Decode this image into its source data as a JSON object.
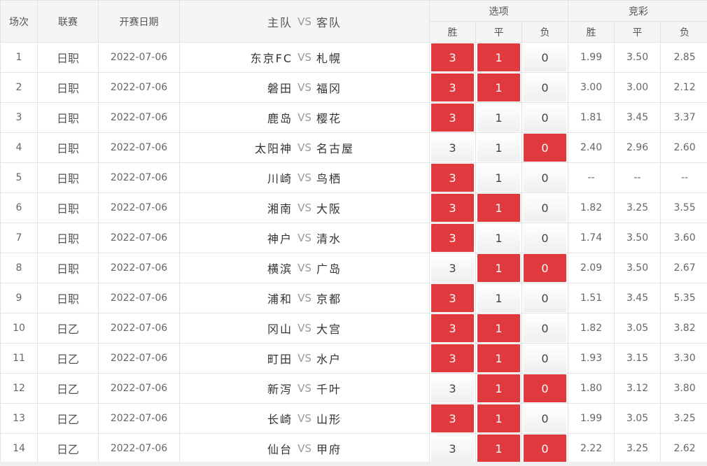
{
  "header": {
    "num": "场次",
    "league": "联赛",
    "date": "开赛日期",
    "home": "主队",
    "vs": "VS",
    "away": "客队",
    "options_group": "选项",
    "odds_group": "竞彩",
    "win": "胜",
    "draw": "平",
    "lose": "负"
  },
  "colors": {
    "selected": "#e03a3e",
    "header_bg": "#f5f5f5",
    "border": "#e3e3e3"
  },
  "rows": [
    {
      "num": "1",
      "league": "日职",
      "date": "2022-07-06",
      "home": "东京FC",
      "away": "札幌",
      "opt": {
        "win": "3",
        "draw": "1",
        "lose": "0"
      },
      "sel": [
        true,
        true,
        false
      ],
      "odds": {
        "win": "1.99",
        "draw": "3.50",
        "lose": "2.85"
      }
    },
    {
      "num": "2",
      "league": "日职",
      "date": "2022-07-06",
      "home": "磐田",
      "away": "福冈",
      "opt": {
        "win": "3",
        "draw": "1",
        "lose": "0"
      },
      "sel": [
        true,
        true,
        false
      ],
      "odds": {
        "win": "3.00",
        "draw": "3.00",
        "lose": "2.12"
      }
    },
    {
      "num": "3",
      "league": "日职",
      "date": "2022-07-06",
      "home": "鹿岛",
      "away": "樱花",
      "opt": {
        "win": "3",
        "draw": "1",
        "lose": "0"
      },
      "sel": [
        true,
        false,
        false
      ],
      "odds": {
        "win": "1.81",
        "draw": "3.45",
        "lose": "3.37"
      }
    },
    {
      "num": "4",
      "league": "日职",
      "date": "2022-07-06",
      "home": "太阳神",
      "away": "名古屋",
      "opt": {
        "win": "3",
        "draw": "1",
        "lose": "0"
      },
      "sel": [
        false,
        false,
        true
      ],
      "odds": {
        "win": "2.40",
        "draw": "2.96",
        "lose": "2.60"
      }
    },
    {
      "num": "5",
      "league": "日职",
      "date": "2022-07-06",
      "home": "川崎",
      "away": "鸟栖",
      "opt": {
        "win": "3",
        "draw": "1",
        "lose": "0"
      },
      "sel": [
        true,
        false,
        false
      ],
      "odds": {
        "win": "--",
        "draw": "--",
        "lose": "--"
      }
    },
    {
      "num": "6",
      "league": "日职",
      "date": "2022-07-06",
      "home": "湘南",
      "away": "大阪",
      "opt": {
        "win": "3",
        "draw": "1",
        "lose": "0"
      },
      "sel": [
        true,
        true,
        false
      ],
      "odds": {
        "win": "1.82",
        "draw": "3.25",
        "lose": "3.55"
      }
    },
    {
      "num": "7",
      "league": "日职",
      "date": "2022-07-06",
      "home": "神户",
      "away": "清水",
      "opt": {
        "win": "3",
        "draw": "1",
        "lose": "0"
      },
      "sel": [
        true,
        false,
        false
      ],
      "odds": {
        "win": "1.74",
        "draw": "3.50",
        "lose": "3.60"
      }
    },
    {
      "num": "8",
      "league": "日职",
      "date": "2022-07-06",
      "home": "横滨",
      "away": "广岛",
      "opt": {
        "win": "3",
        "draw": "1",
        "lose": "0"
      },
      "sel": [
        false,
        true,
        true
      ],
      "odds": {
        "win": "2.09",
        "draw": "3.50",
        "lose": "2.67"
      }
    },
    {
      "num": "9",
      "league": "日职",
      "date": "2022-07-06",
      "home": "浦和",
      "away": "京都",
      "opt": {
        "win": "3",
        "draw": "1",
        "lose": "0"
      },
      "sel": [
        true,
        false,
        false
      ],
      "odds": {
        "win": "1.51",
        "draw": "3.45",
        "lose": "5.35"
      }
    },
    {
      "num": "10",
      "league": "日乙",
      "date": "2022-07-06",
      "home": "冈山",
      "away": "大宫",
      "opt": {
        "win": "3",
        "draw": "1",
        "lose": "0"
      },
      "sel": [
        true,
        true,
        false
      ],
      "odds": {
        "win": "1.82",
        "draw": "3.05",
        "lose": "3.82"
      }
    },
    {
      "num": "11",
      "league": "日乙",
      "date": "2022-07-06",
      "home": "町田",
      "away": "水户",
      "opt": {
        "win": "3",
        "draw": "1",
        "lose": "0"
      },
      "sel": [
        true,
        true,
        false
      ],
      "odds": {
        "win": "1.93",
        "draw": "3.15",
        "lose": "3.30"
      }
    },
    {
      "num": "12",
      "league": "日乙",
      "date": "2022-07-06",
      "home": "新泻",
      "away": "千叶",
      "opt": {
        "win": "3",
        "draw": "1",
        "lose": "0"
      },
      "sel": [
        false,
        true,
        true
      ],
      "odds": {
        "win": "1.80",
        "draw": "3.12",
        "lose": "3.80"
      }
    },
    {
      "num": "13",
      "league": "日乙",
      "date": "2022-07-06",
      "home": "长崎",
      "away": "山形",
      "opt": {
        "win": "3",
        "draw": "1",
        "lose": "0"
      },
      "sel": [
        true,
        true,
        false
      ],
      "odds": {
        "win": "1.99",
        "draw": "3.05",
        "lose": "3.25"
      }
    },
    {
      "num": "14",
      "league": "日乙",
      "date": "2022-07-06",
      "home": "仙台",
      "away": "甲府",
      "opt": {
        "win": "3",
        "draw": "1",
        "lose": "0"
      },
      "sel": [
        false,
        true,
        true
      ],
      "odds": {
        "win": "2.22",
        "draw": "3.25",
        "lose": "2.62"
      }
    }
  ]
}
